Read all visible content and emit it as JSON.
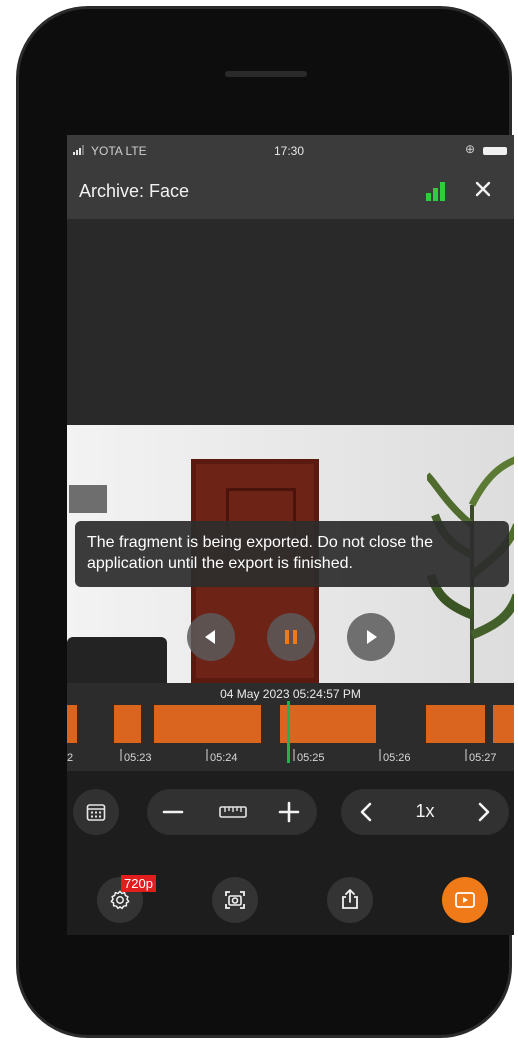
{
  "status_bar": {
    "carrier": "YOTA  LTE",
    "time": "17:30"
  },
  "header": {
    "title": "Archive: Face",
    "signal_icon": "signal-bars-icon",
    "close_icon": "close-icon",
    "accent": "#2ecc40"
  },
  "toast": {
    "message": "The fragment is being exported. Do not close the application until the export is finished."
  },
  "player": {
    "prev_icon": "step-back-icon",
    "pause_icon": "pause-icon",
    "next_icon": "play-icon",
    "pause_color": "#f07a18"
  },
  "timeline": {
    "datetime": "04 May 2023 05:24:57 PM",
    "ticks": [
      "2",
      "05:23",
      "05:24",
      "05:25",
      "05:26",
      "05:27"
    ],
    "segment_color": "#d9651e",
    "cursor_color": "#22b14c"
  },
  "controls": {
    "calendar_icon": "calendar-icon",
    "zoom_out_icon": "minus-icon",
    "ruler_icon": "ruler-icon",
    "zoom_in_icon": "plus-icon",
    "speed_prev_icon": "chevron-left-icon",
    "speed": "1x",
    "speed_next_icon": "chevron-right-icon"
  },
  "toolbar": {
    "quality_badge": "720p",
    "settings_icon": "gear-icon",
    "snapshot_icon": "camera-icon",
    "share_icon": "share-icon",
    "export_icon": "export-video-icon",
    "export_color": "#f07a18"
  }
}
